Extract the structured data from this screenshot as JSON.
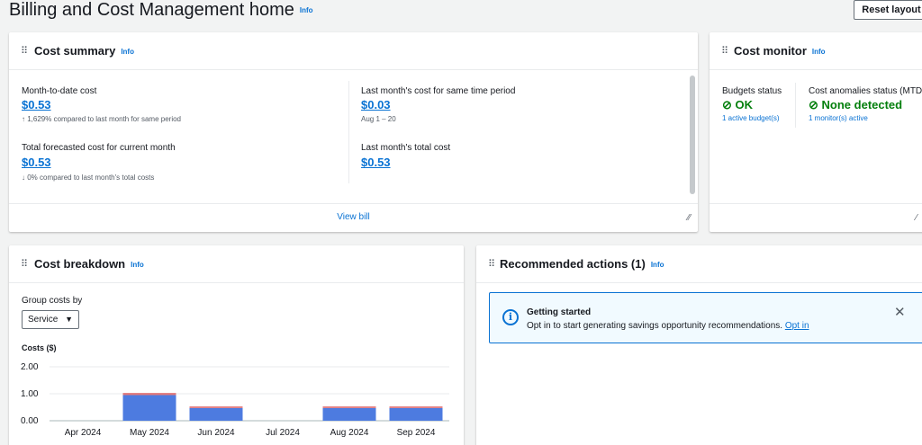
{
  "page": {
    "title": "Billing and Cost Management home",
    "info": "Info",
    "reset_layout": "Reset layout"
  },
  "cost_summary": {
    "title": "Cost summary",
    "info": "Info",
    "mtd_label": "Month-to-date cost",
    "mtd_value": "$0.53",
    "mtd_note": "1,629% compared to last month for same period",
    "last_same_label": "Last month's cost for same time period",
    "last_same_value": "$0.03",
    "last_same_note": "Aug 1 – 20",
    "forecast_label": "Total forecasted cost for current month",
    "forecast_value": "$0.53",
    "forecast_note": "0% compared to last month's total costs",
    "last_total_label": "Last month's total cost",
    "last_total_value": "$0.53",
    "view_bill": "View bill",
    "up_arrow": "↑",
    "down_arrow": "↓"
  },
  "cost_monitor": {
    "title": "Cost monitor",
    "info": "Info",
    "budgets_label": "Budgets status",
    "budgets_value": "OK",
    "budgets_link": "1 active budget(s)",
    "anomalies_label": "Cost anomalies status (MTD)",
    "anomalies_value": "None detected",
    "anomalies_link": "1 monitor(s) active"
  },
  "cost_breakdown": {
    "title": "Cost breakdown",
    "info": "Info",
    "group_label": "Group costs by",
    "group_value": "Service"
  },
  "recommended": {
    "title": "Recommended actions (1)",
    "info": "Info",
    "alert_title": "Getting started",
    "alert_text": "Opt in to start generating savings opportunity recommendations.",
    "alert_link": "Opt in"
  },
  "colors": {
    "series_main": "#4d7be0",
    "series_top": "#e0787c",
    "link": "#0972d3",
    "ok": "#037f0c"
  },
  "chart_data": {
    "type": "bar",
    "ylabel": "Costs ($)",
    "ylim": [
      0,
      2
    ],
    "yticks": [
      "2.00",
      "1.00",
      "0.00"
    ],
    "categories": [
      "Apr 2024",
      "May 2024",
      "Jun 2024",
      "Jul 2024",
      "Aug 2024",
      "Sep 2024"
    ],
    "series": [
      {
        "values": [
          0,
          0.95,
          0.47,
          0,
          0.47,
          0.47
        ]
      },
      {
        "values": [
          0,
          0.08,
          0.06,
          0,
          0.06,
          0.06
        ]
      }
    ]
  }
}
